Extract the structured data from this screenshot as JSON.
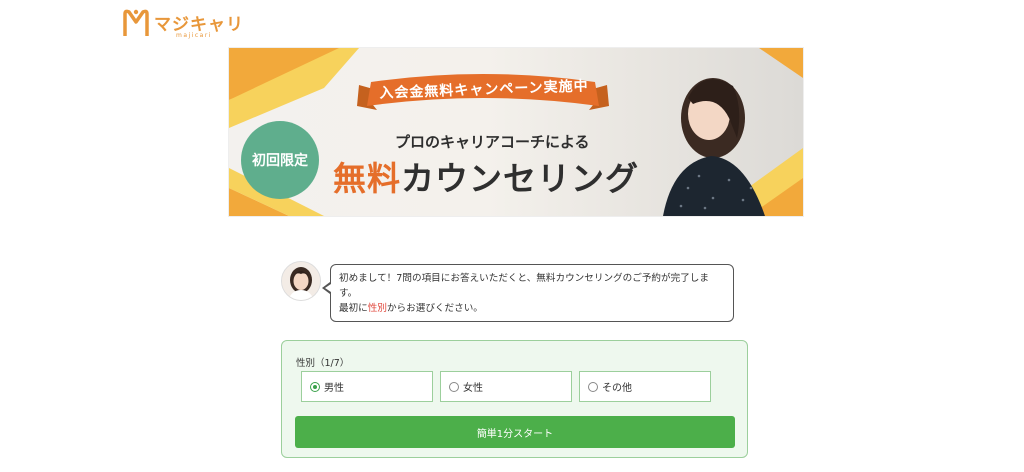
{
  "logo": {
    "text": "マジキャリ",
    "sub": "majicari",
    "color": "#e8973a"
  },
  "banner": {
    "ribbon": "入会金無料キャンペーン実施中",
    "badge": "初回限定",
    "subheading": "プロのキャリアコーチによる",
    "headline_accent": "無料",
    "headline_rest": "カウンセリング",
    "colors": {
      "yellow": "#f4c542",
      "orange": "#e56e2a",
      "green": "#5fae8d"
    }
  },
  "chat": {
    "line1": "初めまして！7問の項目にお答えいただくと、無料カウンセリングのご予約が完了しま",
    "line2": "す。",
    "line3_before": "最初に",
    "line3_highlight": "性別",
    "line3_after": "からお選びください。"
  },
  "form": {
    "question": "性別（1/7）",
    "options": [
      {
        "label": "男性",
        "checked": true
      },
      {
        "label": "女性",
        "checked": false
      },
      {
        "label": "その他",
        "checked": false
      }
    ],
    "start_button": "簡単1分スタート",
    "accent": "#4caf4a"
  }
}
